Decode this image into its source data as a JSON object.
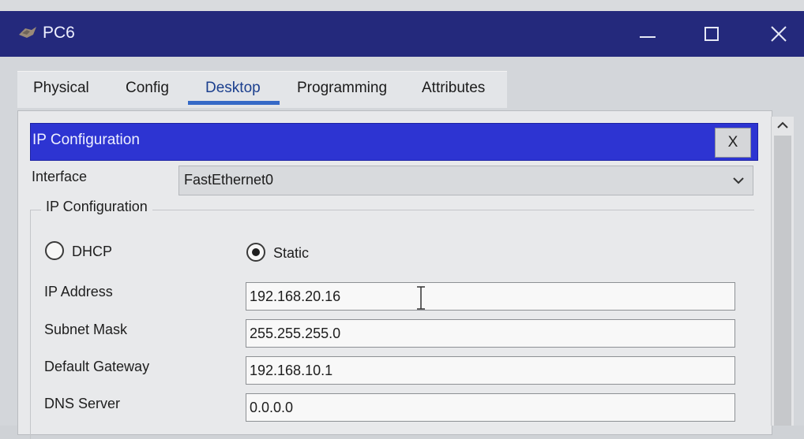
{
  "window": {
    "title": "PC6"
  },
  "tabs": [
    {
      "label": "Physical"
    },
    {
      "label": "Config"
    },
    {
      "label": "Desktop"
    },
    {
      "label": "Programming"
    },
    {
      "label": "Attributes"
    }
  ],
  "active_tab": "Desktop",
  "ip_panel": {
    "title": "IP Configuration",
    "close_label": "X",
    "interface_label": "Interface",
    "interface_value": "FastEthernet0",
    "group_title": "IP Configuration",
    "dhcp_label": "DHCP",
    "static_label": "Static",
    "selected_mode": "Static",
    "fields": {
      "ip_address": {
        "label": "IP Address",
        "value": "192.168.20.16"
      },
      "subnet_mask": {
        "label": "Subnet Mask",
        "value": "255.255.255.0"
      },
      "default_gateway": {
        "label": "Default Gateway",
        "value": "192.168.10.1"
      },
      "dns_server": {
        "label": "DNS Server",
        "value": "0.0.0.0"
      }
    }
  },
  "colors": {
    "title_bar": "#24297c",
    "panel_header": "#2d34d2",
    "active_tab_underline": "#3569c7"
  },
  "icons": {
    "app": "packet-tracer-pc-icon",
    "minimize": "minimize-icon",
    "maximize": "maximize-icon",
    "close": "close-icon",
    "dropdown": "chevron-down-icon",
    "scroll_up": "chevron-up-icon"
  }
}
